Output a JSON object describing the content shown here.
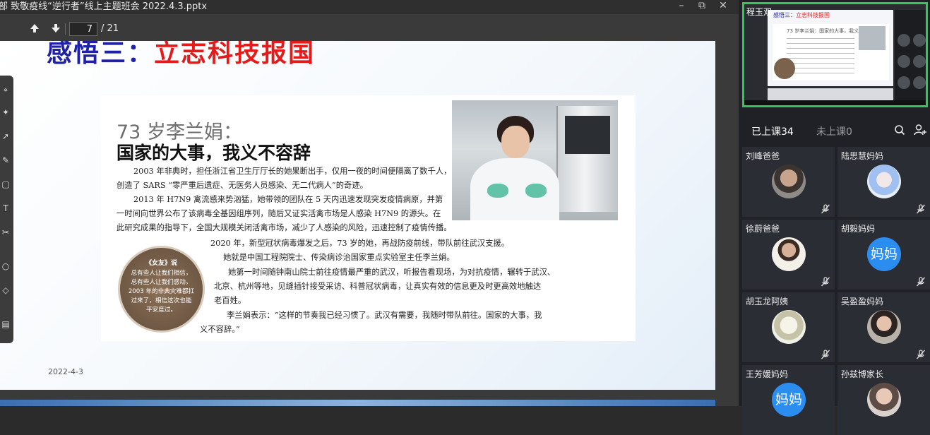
{
  "window": {
    "title": "部 致敬疫线“逆行者”线上主题班会 2022.4.3.pptx",
    "minimize": "–",
    "restore": "⧉",
    "close": "✕"
  },
  "toolbar": {
    "current_page": "7",
    "total_pages": "/ 21"
  },
  "slide": {
    "heading_blue": "感悟三：",
    "heading_red": "立志科技报国",
    "date": "2022-4-3",
    "article": {
      "subtitle": "73 岁李兰娟：",
      "title": "国家的大事，我义不容辞",
      "paragraphs": [
        "2003 年非典时，担任浙江省卫生厅厅长的她果断出手，仅用一夜的时间便隔离了数千人，",
        "创造了 SARS “零严重后遗症、无医务人员感染、无二代病人”的奇迹。",
        "2013 年 H7N9 禽流感来势汹猛，她带领的团队在 5 天内迅速发现突发疫情病原，并第",
        "一时间向世界公布了该病毒全基因组序列，随后又证实活禽市场是人感染 H7N9 的源头。在",
        "此研究成果的指导下，全国大规模关闭活禽市场，减少了人感染的风险，迅速控制了疫情传播。",
        "2020 年，新型冠状病毒爆发之后，73 岁的她，再战防疫前线，带队前往武汉支援。",
        "她就是中国工程院院士、传染病诊治国家重点实验室主任李兰娟。",
        "她第一时间随钟南山院士前往疫情最严重的武汉，听报告看现场，为对抗疫情，辗转于武汉、",
        "北京、杭州等地，见缝插针接受采访、科普冠状病毒，让真实有效的信息更及时更高效地触达",
        "老百姓。",
        "李兰娟表示：“这样的节奏我已经习惯了。武汉有需要，我随时带队前往。国家的大事，我",
        "义不容辞。”"
      ],
      "badge": {
        "head": "《女友》说",
        "lines": [
          "总有些人让我们相信，",
          "总有些人让我们感动。",
          "2003 年的非典灾难都扛",
          "过来了，相信这次也能",
          "平安度过。"
        ]
      }
    }
  },
  "preview": {
    "presenter_name": "程玉双",
    "mini_title_blue": "感悟三：",
    "mini_title_red": "立志科技报国",
    "mini_subtitle": "73 岁李兰娟：国家的大事，我义不容辞"
  },
  "attendance": {
    "online_tab": "已上课34",
    "offline_tab": "未上课0"
  },
  "participants": [
    {
      "name": "刘峰爸爸",
      "avatar": "photo"
    },
    {
      "name": "陆思慧妈妈",
      "avatar": "photo"
    },
    {
      "name": "徐蔚爸爸",
      "avatar": "photo"
    },
    {
      "name": "胡毅妈妈",
      "avatar": "text",
      "avatar_text": "妈妈"
    },
    {
      "name": "胡玉龙阿姨",
      "avatar": "photo"
    },
    {
      "name": "吴盈盈妈妈",
      "avatar": "photo"
    },
    {
      "name": "王芳媛妈妈",
      "avatar": "text",
      "avatar_text": "妈妈"
    },
    {
      "name": "孙兹博家长",
      "avatar": "photo"
    }
  ],
  "colors": {
    "heading_blue": "#1f22a8",
    "heading_red": "#e51b1b",
    "active_speaker_border": "#31c75a",
    "text_avatar_bg": "#2c8df0"
  },
  "icons": [
    "arrow-up-icon",
    "arrow-down-icon",
    "search-icon",
    "invite-user-icon",
    "mic-muted-icon"
  ]
}
